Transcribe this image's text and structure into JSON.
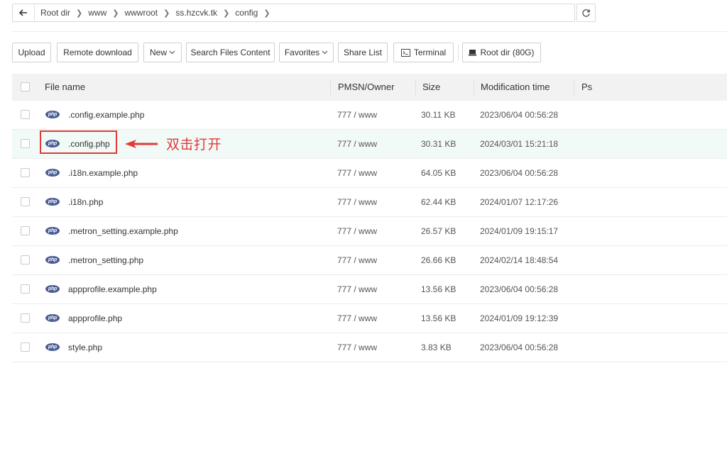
{
  "breadcrumb": [
    "Root dir",
    "www",
    "wwwroot",
    "ss.hzcvk.tk",
    "config"
  ],
  "toolbar": {
    "upload": "Upload",
    "remote_download": "Remote download",
    "new": "New",
    "search": "Search Files Content",
    "favorites": "Favorites",
    "share_list": "Share List",
    "terminal": "Terminal",
    "root_dir": "Root dir (80G)"
  },
  "table": {
    "headers": {
      "name": "File name",
      "perm": "PMSN/Owner",
      "size": "Size",
      "mtime": "Modification time",
      "ps": "Ps"
    },
    "rows": [
      {
        "name": ".config.example.php",
        "perm": "777 / www",
        "size": "30.11 KB",
        "mtime": "2023/06/04 00:56:28"
      },
      {
        "name": ".config.php",
        "perm": "777 / www",
        "size": "30.31 KB",
        "mtime": "2024/03/01 15:21:18"
      },
      {
        "name": ".i18n.example.php",
        "perm": "777 / www",
        "size": "64.05 KB",
        "mtime": "2023/06/04 00:56:28"
      },
      {
        "name": ".i18n.php",
        "perm": "777 / www",
        "size": "62.44 KB",
        "mtime": "2024/01/07 12:17:26"
      },
      {
        "name": ".metron_setting.example.php",
        "perm": "777 / www",
        "size": "26.57 KB",
        "mtime": "2024/01/09 19:15:17"
      },
      {
        "name": ".metron_setting.php",
        "perm": "777 / www",
        "size": "26.66 KB",
        "mtime": "2024/02/14 18:48:54"
      },
      {
        "name": "appprofile.example.php",
        "perm": "777 / www",
        "size": "13.56 KB",
        "mtime": "2023/06/04 00:56:28"
      },
      {
        "name": "appprofile.php",
        "perm": "777 / www",
        "size": "13.56 KB",
        "mtime": "2024/01/09 19:12:39"
      },
      {
        "name": "style.php",
        "perm": "777 / www",
        "size": "3.83 KB",
        "mtime": "2023/06/04 00:56:28"
      }
    ]
  },
  "file_icon_label": "php",
  "annotation": {
    "text": "双击打开",
    "color": "#e03a3a"
  },
  "colors": {
    "highlight_row": "#f1faf6",
    "php_icon": "#4a5d96"
  }
}
